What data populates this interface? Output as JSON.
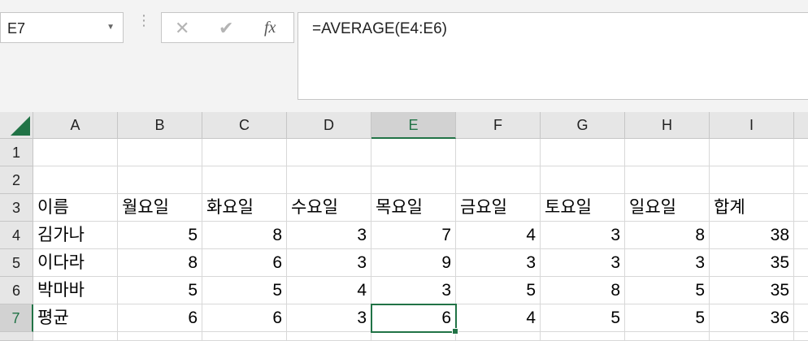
{
  "name_box": {
    "value": "E7"
  },
  "formula_bar": {
    "cancel_symbol": "✕",
    "enter_symbol": "✔",
    "fx_symbol": "fx",
    "formula": "=AVERAGE(E4:E6)"
  },
  "accent_color": "#217346",
  "selected_cell": "E7",
  "columns": [
    "A",
    "B",
    "C",
    "D",
    "E",
    "F",
    "G",
    "H",
    "I"
  ],
  "rows": [
    "1",
    "2",
    "3",
    "4",
    "5",
    "6",
    "7"
  ],
  "cells": {
    "r1": [
      "",
      "",
      "",
      "",
      "",
      "",
      "",
      "",
      ""
    ],
    "r2": [
      "",
      "",
      "",
      "",
      "",
      "",
      "",
      "",
      ""
    ],
    "r3": [
      "이름",
      "월요일",
      "화요일",
      "수요일",
      "목요일",
      "금요일",
      "토요일",
      "일요일",
      "합계"
    ],
    "r4": [
      "김가나",
      "5",
      "8",
      "3",
      "7",
      "4",
      "3",
      "8",
      "38"
    ],
    "r5": [
      "이다라",
      "8",
      "6",
      "3",
      "9",
      "3",
      "3",
      "3",
      "35"
    ],
    "r6": [
      "박마바",
      "5",
      "5",
      "4",
      "3",
      "5",
      "8",
      "5",
      "35"
    ],
    "r7": [
      "평균",
      "6",
      "6",
      "3",
      "6",
      "4",
      "5",
      "5",
      "36"
    ]
  }
}
